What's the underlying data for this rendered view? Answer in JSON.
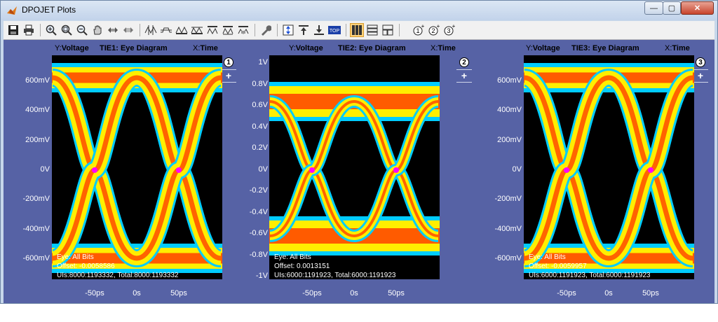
{
  "window": {
    "title": "DPOJET Plots",
    "minimize": "—",
    "maximize": "▢",
    "close": "✕"
  },
  "toolbar": {
    "icons": [
      "save-icon",
      "print-icon",
      "zoom-in-icon",
      "zoom-in-box-icon",
      "zoom-out-icon",
      "pan-hand-icon",
      "pan-h-icon",
      "pan-v-icon",
      "cursor-vert-icon",
      "cursor-waveform-icon",
      "cursor-horiz-a-icon",
      "cursor-horiz-b-icon",
      "cursor-track-a-icon",
      "cursor-track-b-icon",
      "cursor-track-c-icon",
      "settings-wrench-icon",
      "autoscale-icon",
      "align-top-icon",
      "align-bottom-icon",
      "top-label-icon",
      "layout-columns-icon",
      "layout-rows-icon",
      "layout-grid-icon",
      "plot1-add-icon",
      "plot2-add-icon",
      "plot3-add-icon"
    ]
  },
  "plots": [
    {
      "y_label": "Y:",
      "y_name": "Voltage",
      "title": "TIE1: Eye Diagram",
      "x_label": "X:",
      "x_name": "Time",
      "number": "1",
      "plus": "+",
      "y_ticks": [
        "600mV",
        "400mV",
        "200mV",
        "0V",
        "-200mV",
        "-400mV",
        "-600mV"
      ],
      "x_ticks": [
        "-50ps",
        "0s",
        "50ps"
      ],
      "info": [
        "Eye: All Bits",
        "Offset: -0.0058586",
        "UIs:8000:1193332, Total:8000:1193332"
      ]
    },
    {
      "y_label": "Y:",
      "y_name": "Voltage",
      "title": "TIE2: Eye Diagram",
      "x_label": "X:",
      "x_name": "Time",
      "number": "2",
      "plus": "+",
      "y_ticks": [
        "1V",
        "0.8V",
        "0.6V",
        "0.4V",
        "0.2V",
        "0V",
        "-0.2V",
        "-0.4V",
        "-0.6V",
        "-0.8V",
        "-1V"
      ],
      "x_ticks": [
        "-50ps",
        "0s",
        "50ps"
      ],
      "info": [
        "Eye: All Bits",
        "Offset: 0.0013151",
        "UIs:6000:1191923, Total:6000:1191923"
      ]
    },
    {
      "y_label": "Y:",
      "y_name": "Voltage",
      "title": "TIE3: Eye Diagram",
      "x_label": "X:",
      "x_name": "Time",
      "number": "3",
      "plus": "+",
      "y_ticks": [
        "600mV",
        "400mV",
        "200mV",
        "0V",
        "-200mV",
        "-400mV",
        "-600mV"
      ],
      "x_ticks": [
        "-50ps",
        "0s",
        "50ps"
      ],
      "info": [
        "Eye: All Bits",
        "Offset: -0.0059957",
        "UIs:6000:1191923, Total:6000:1191923"
      ]
    }
  ],
  "colors": {
    "plot_bg": "#5662a5",
    "eye_outer": "#ff2a00",
    "eye_mid": "#ffee00",
    "eye_edge": "#00ccff",
    "crossing": "#ff00ff"
  }
}
